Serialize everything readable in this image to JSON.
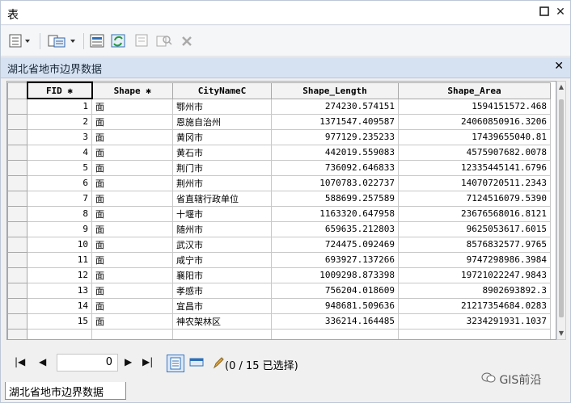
{
  "window": {
    "title": "表"
  },
  "tab": {
    "title": "湖北省地市边界数据",
    "bottom_label": "湖北省地市边界数据"
  },
  "columns": [
    "FID ✱",
    "Shape ✱",
    "CityNameC",
    "Shape_Length",
    "Shape_Area"
  ],
  "rows": [
    {
      "fid": "1",
      "shape": "面",
      "city": "鄂州市",
      "length": "274230.574151",
      "area": "1594151572.468"
    },
    {
      "fid": "2",
      "shape": "面",
      "city": "恩施自治州",
      "length": "1371547.409587",
      "area": "24060850916.3206"
    },
    {
      "fid": "3",
      "shape": "面",
      "city": "黄冈市",
      "length": "977129.235233",
      "area": "17439655040.81"
    },
    {
      "fid": "4",
      "shape": "面",
      "city": "黄石市",
      "length": "442019.559083",
      "area": "4575907682.0078"
    },
    {
      "fid": "5",
      "shape": "面",
      "city": "荆门市",
      "length": "736092.646833",
      "area": "12335445141.6796"
    },
    {
      "fid": "6",
      "shape": "面",
      "city": "荆州市",
      "length": "1070783.022737",
      "area": "14070720511.2343"
    },
    {
      "fid": "7",
      "shape": "面",
      "city": "省直辖行政单位",
      "length": "588699.257589",
      "area": "7124516079.5390"
    },
    {
      "fid": "8",
      "shape": "面",
      "city": "十堰市",
      "length": "1163320.647958",
      "area": "23676568016.8121"
    },
    {
      "fid": "9",
      "shape": "面",
      "city": "随州市",
      "length": "659635.212803",
      "area": "9625053617.6015"
    },
    {
      "fid": "10",
      "shape": "面",
      "city": "武汉市",
      "length": "724475.092469",
      "area": "8576832577.9765"
    },
    {
      "fid": "11",
      "shape": "面",
      "city": "咸宁市",
      "length": "693927.137266",
      "area": "9747298986.3984"
    },
    {
      "fid": "12",
      "shape": "面",
      "city": "襄阳市",
      "length": "1009298.873398",
      "area": "19721022247.9843"
    },
    {
      "fid": "13",
      "shape": "面",
      "city": "孝感市",
      "length": "756204.018609",
      "area": "8902693892.3"
    },
    {
      "fid": "14",
      "shape": "面",
      "city": "宜昌市",
      "length": "948681.509636",
      "area": "21217354684.0283"
    },
    {
      "fid": "15",
      "shape": "面",
      "city": "神农架林区",
      "length": "336214.164485",
      "area": "3234291931.1037"
    }
  ],
  "navigation": {
    "record_value": "0",
    "selection_text": "(0 / 15 已选择)"
  },
  "watermark": "GIS前沿",
  "colors": {
    "tab_header_bg": "#d6e2f2",
    "view_button_active": "#3b76c0"
  }
}
